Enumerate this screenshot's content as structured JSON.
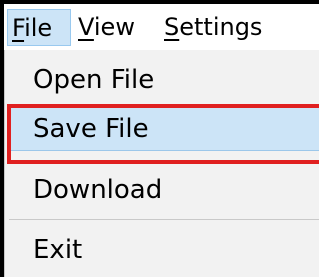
{
  "menubar": {
    "items": [
      {
        "label_accel": "F",
        "label_rest": "ile"
      },
      {
        "label_accel": "V",
        "label_rest": "iew"
      },
      {
        "label_accel": "S",
        "label_rest": "ettings"
      }
    ],
    "active_index": 0
  },
  "file_menu": {
    "items": [
      {
        "label": "Open File"
      },
      {
        "label": "Save File"
      },
      {
        "label": "Download"
      },
      {
        "label": "Exit"
      }
    ],
    "highlighted_item": "Save File"
  },
  "colors": {
    "highlight_background": "#cce4f7",
    "annotation_border": "#e02020",
    "menu_background": "#f2f2f2"
  }
}
